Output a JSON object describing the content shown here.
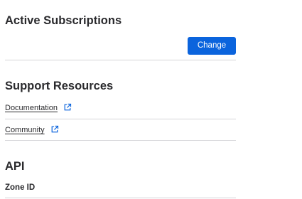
{
  "subscriptions": {
    "title": "Active Subscriptions",
    "change_label": "Change"
  },
  "support": {
    "title": "Support Resources",
    "links": [
      {
        "label": "Documentation",
        "icon": "external-link-icon"
      },
      {
        "label": "Community",
        "icon": "external-link-icon"
      }
    ]
  },
  "api": {
    "title": "API",
    "zone_id_label": "Zone ID"
  },
  "colors": {
    "primary_button": "#0b64dd",
    "divider": "#d4d4d8",
    "text": "#2a2a2d",
    "link_icon": "#0b64dd"
  }
}
